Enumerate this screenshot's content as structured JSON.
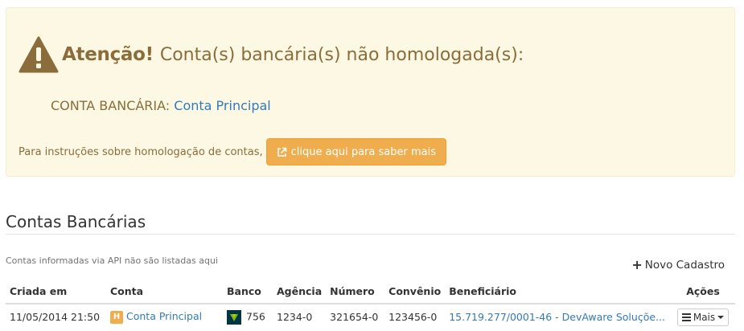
{
  "alert": {
    "title_strong": "Atenção!",
    "title_rest": "Conta(s) bancária(s) não homologada(s):",
    "account_label": "CONTA BANCÁRIA: ",
    "account_link": "Conta Principal",
    "instructions": "Para instruções sobre homologação de contas,",
    "button_label": "clique aqui para saber mais"
  },
  "section": {
    "title": "Contas Bancárias",
    "note": "Contas informadas via API não são listadas aqui",
    "new_button": "Novo Cadastro"
  },
  "table": {
    "headers": {
      "created": "Criada em",
      "account": "Conta",
      "bank": "Banco",
      "agency": "Agência",
      "number": "Número",
      "agreement": "Convênio",
      "beneficiary": "Beneficiário",
      "actions": "Ações"
    },
    "rows": [
      {
        "created": "11/05/2014 21:50",
        "badge": "H",
        "account": "Conta Principal",
        "bank": "756",
        "agency": "1234-0",
        "number": "321654-0",
        "agreement": "123456-0",
        "beneficiary": "15.719.277/0001-46 - DevAware Soluçõe...",
        "action": "Mais"
      }
    ]
  },
  "colors": {
    "alert_bg": "#fcf8e3",
    "alert_text": "#8a6d3b",
    "warning_button": "#f0ad4e",
    "link": "#337ab7"
  }
}
